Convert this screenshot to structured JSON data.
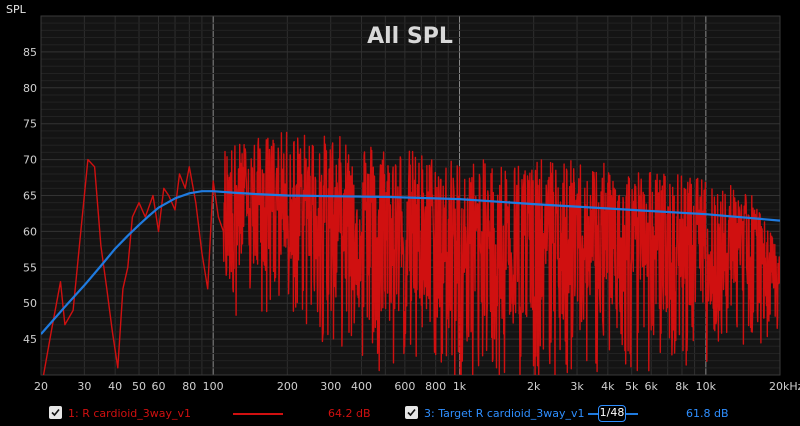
{
  "chart_data": {
    "type": "line",
    "title": "All SPL",
    "ylabel": "SPL",
    "xlabel": "",
    "x_scale": "log",
    "xlim": [
      20,
      20000
    ],
    "ylim": [
      40,
      90
    ],
    "grid": true,
    "y_ticks": [
      "85",
      "80",
      "75",
      "70",
      "65",
      "60",
      "55",
      "50",
      "45"
    ],
    "x_ticks": [
      "20",
      "30",
      "40",
      "50",
      "60",
      "80",
      "100",
      "200",
      "300",
      "400",
      "600",
      "800",
      "1k",
      "2k",
      "3k",
      "4k",
      "5k",
      "6k",
      "8k",
      "10k",
      "20kHz"
    ],
    "series": [
      {
        "name": "1: R cardioid_3way_v1",
        "color": "#d01010",
        "level": "64.2 dB",
        "x": [
          20,
          22,
          24,
          25,
          27,
          29,
          31,
          33,
          35,
          37,
          39,
          41,
          43,
          45,
          47,
          50,
          53,
          57,
          60,
          63,
          66,
          70,
          73,
          77,
          80,
          85,
          90,
          95,
          100,
          105,
          110
        ],
        "y": [
          38,
          46,
          53,
          47,
          49,
          60,
          70,
          69,
          58,
          52,
          46,
          41,
          52,
          55,
          62,
          64,
          62,
          65,
          60,
          66,
          65,
          63,
          68,
          66,
          69,
          64,
          57,
          52,
          67,
          62,
          60
        ],
        "noise_from_hz": 110,
        "noise_envelope_top": [
          [
            110,
            72
          ],
          [
            200,
            74
          ],
          [
            400,
            73
          ],
          [
            1000,
            70
          ],
          [
            3000,
            70
          ],
          [
            8000,
            68
          ],
          [
            15000,
            66
          ],
          [
            20000,
            57
          ]
        ],
        "noise_envelope_bottom": [
          [
            110,
            48
          ],
          [
            200,
            46
          ],
          [
            500,
            40
          ],
          [
            1000,
            38
          ],
          [
            5000,
            39
          ],
          [
            12000,
            42
          ],
          [
            20000,
            45
          ]
        ]
      },
      {
        "name": "3: Target R cardioid_3way_v1",
        "color": "#1f7be0",
        "level": "61.8 dB",
        "smoothing": "1/48",
        "x": [
          20,
          25,
          30,
          35,
          40,
          45,
          50,
          55,
          60,
          70,
          80,
          90,
          100,
          120,
          150,
          200,
          300,
          500,
          1000,
          2000,
          5000,
          10000,
          20000
        ],
        "y": [
          45.7,
          49.5,
          52.5,
          55.2,
          57.6,
          59.4,
          60.9,
          62.2,
          63.3,
          64.6,
          65.3,
          65.6,
          65.6,
          65.4,
          65.2,
          65.0,
          64.9,
          64.8,
          64.5,
          63.8,
          63.0,
          62.4,
          61.5
        ]
      }
    ]
  },
  "legend": {
    "items": [
      {
        "label": "1: R cardioid_3way_v1",
        "value": "64.2 dB",
        "color": "#d01010"
      },
      {
        "label": "3: Target R cardioid_3way_v1",
        "value": "61.8 dB",
        "color": "#1f7be0"
      }
    ],
    "smoothing_label": "1/48"
  }
}
